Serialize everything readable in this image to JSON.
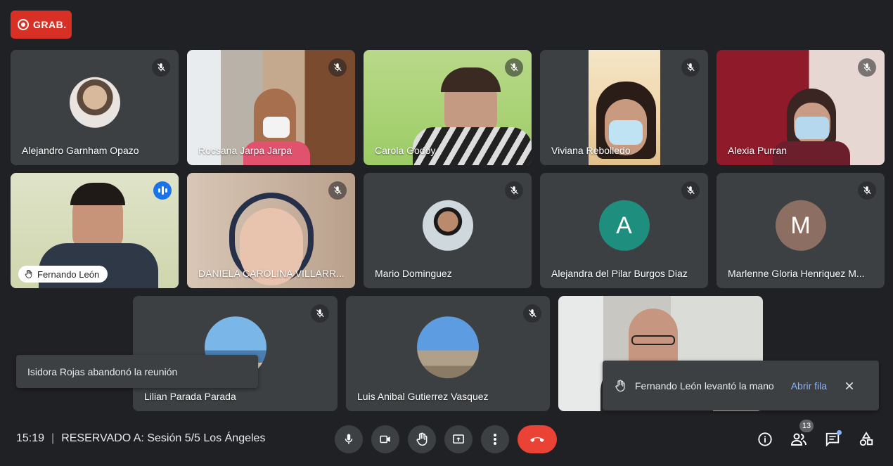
{
  "recording": {
    "label": "GRAB."
  },
  "participants": [
    {
      "name": "Alejandro Garnham Opazo",
      "state": "muted"
    },
    {
      "name": "Rocsana Jarpa Jarpa",
      "state": "muted"
    },
    {
      "name": "Carola Godoy",
      "state": "muted"
    },
    {
      "name": "Viviana Rebolledo",
      "state": "muted"
    },
    {
      "name": "Alexia Purran",
      "state": "muted"
    },
    {
      "name": "Fernando León",
      "state": "speaking",
      "hand_raised": true
    },
    {
      "name": "DANIELA CAROLINA VILLARR...",
      "state": "muted"
    },
    {
      "name": "Mario Dominguez",
      "state": "muted"
    },
    {
      "name": "Alejandra del Pilar Burgos Diaz",
      "state": "muted",
      "initial": "A",
      "avatar_color": "#1e8e7e"
    },
    {
      "name": "Marlenne Gloria Henriquez M...",
      "state": "muted",
      "initial": "M",
      "avatar_color": "#8d6e63"
    },
    {
      "name": "Lilian Parada Parada",
      "state": "muted"
    },
    {
      "name": "Luis Anibal Gutierrez Vasquez",
      "state": "muted"
    },
    {
      "name": "",
      "state": "video"
    }
  ],
  "toasts": {
    "left": {
      "text": "Isidora Rojas abandonó la reunión"
    },
    "right": {
      "text": "Fernando León levantó la mano",
      "action": "Abrir fila"
    }
  },
  "footer": {
    "time": "15:19",
    "separator": "|",
    "meeting_title": "RESERVADO A: Sesión 5/5 Los Ángeles",
    "participant_count": "13"
  },
  "colors": {
    "background": "#202124",
    "tile": "#3c4043",
    "recording": "#d93025",
    "hangup": "#ea4335",
    "accent": "#8ab4f8",
    "speaking": "#1a73e8"
  },
  "icons": [
    "record-icon",
    "mic-off-icon",
    "speaking-icon",
    "hand-icon",
    "mic-icon",
    "camera-icon",
    "present-icon",
    "more-icon",
    "hangup-icon",
    "info-icon",
    "people-icon",
    "chat-icon",
    "activities-icon",
    "close-icon"
  ]
}
